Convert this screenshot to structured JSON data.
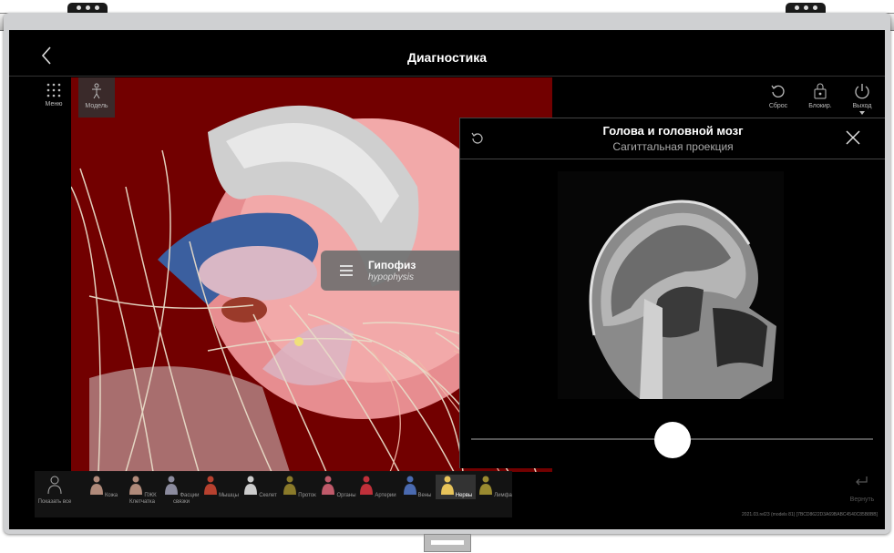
{
  "header": {
    "title": "Диагностика"
  },
  "toolbar_left": {
    "menu_label": "Меню",
    "model_label": "Модель"
  },
  "toolbar_right": {
    "reset_label": "Сброс",
    "lock_label": "Блокир.",
    "exit_label": "Выход"
  },
  "structure_label": {
    "name_ru": "Гипофиз",
    "name_lat": "hypophysis"
  },
  "panel": {
    "title": "Голова и головной мозг",
    "subtitle": "Сагиттальная проекция",
    "slice_position": 0.5
  },
  "layers": {
    "show_all": "Показать все",
    "items": [
      {
        "label": "Кожа",
        "color": "#b08a7a"
      },
      {
        "label": "ПЖК\nКлетчатка",
        "color": "#b08a7a"
      },
      {
        "label": "Фасции\nсвязки",
        "color": "#8b8b9e"
      },
      {
        "label": "Мышцы",
        "color": "#b7412f"
      },
      {
        "label": "Скелет",
        "color": "#cccccc"
      },
      {
        "label": "Проток",
        "color": "#8a7a2a"
      },
      {
        "label": "Органы",
        "color": "#c05a6a"
      },
      {
        "label": "Артерии",
        "color": "#c0303a"
      },
      {
        "label": "Вены",
        "color": "#4a6ab0"
      },
      {
        "label": "Нервы",
        "color": "#e8c45a"
      },
      {
        "label": "Лимфа",
        "color": "#9a8a30"
      }
    ],
    "active": "Нервы"
  },
  "return_label": "Вернуть",
  "version": "2021.03.rel23 (models 81) [7BCD8622D3A69BABC4540C85B8BB]"
}
